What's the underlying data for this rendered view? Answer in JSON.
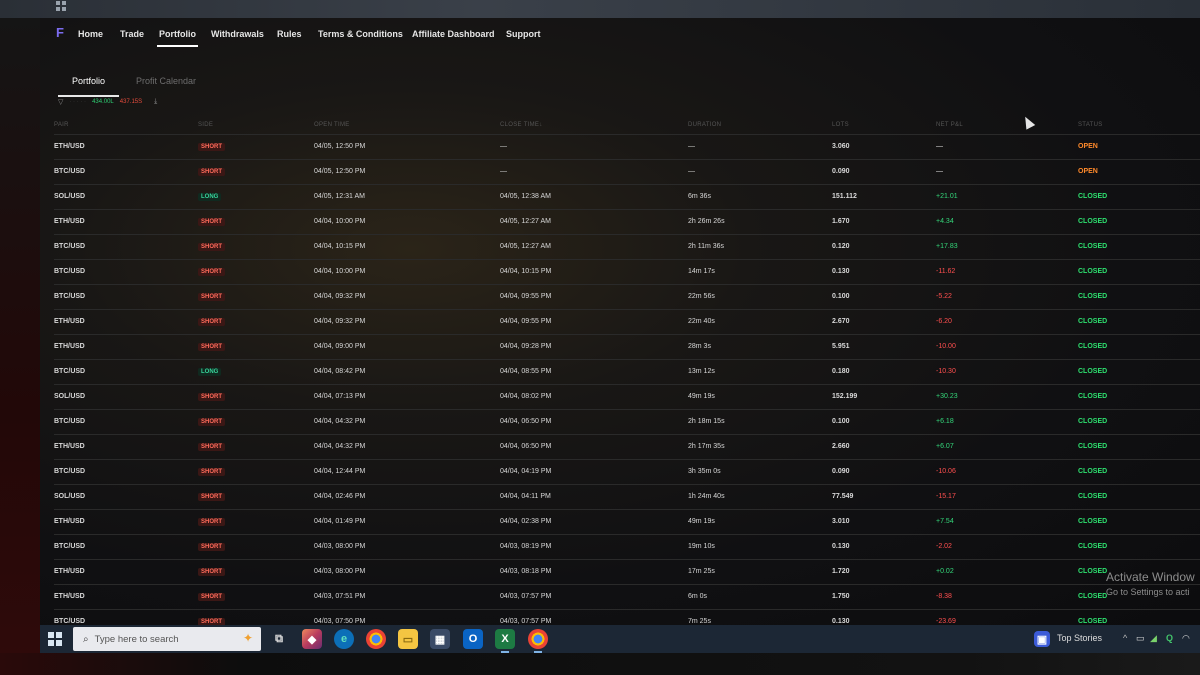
{
  "nav": {
    "items": [
      "Home",
      "Trade",
      "Portfolio",
      "Withdrawals",
      "Rules",
      "Terms & Conditions",
      "Affiliate Dashboard",
      "Support"
    ],
    "active": "Portfolio"
  },
  "subtabs": {
    "portfolio": "Portfolio",
    "calendar": "Profit Calendar"
  },
  "summary": {
    "positive": "434.00L",
    "negative": "437.15S"
  },
  "table": {
    "headers": {
      "pair": "PAIR",
      "side": "SIDE",
      "open_time": "OPEN TIME",
      "close_time": "CLOSE TIME↓",
      "duration": "DURATION",
      "lots": "LOTS",
      "net_pnl": "NET P&L",
      "status": "STATUS"
    },
    "rows": [
      {
        "pair": "ETH/USD",
        "side": "SHORT",
        "open": "04/05, 12:50 PM",
        "close": "—",
        "duration": "—",
        "lots": "3.060",
        "pnl": "—",
        "status": "OPEN"
      },
      {
        "pair": "BTC/USD",
        "side": "SHORT",
        "open": "04/05, 12:50 PM",
        "close": "—",
        "duration": "—",
        "lots": "0.090",
        "pnl": "—",
        "status": "OPEN"
      },
      {
        "pair": "SOL/USD",
        "side": "LONG",
        "open": "04/05, 12:31 AM",
        "close": "04/05, 12:38 AM",
        "duration": "6m 36s",
        "lots": "151.112",
        "pnl": "+21.01",
        "status": "CLOSED"
      },
      {
        "pair": "ETH/USD",
        "side": "SHORT",
        "open": "04/04, 10:00 PM",
        "close": "04/05, 12:27 AM",
        "duration": "2h 26m 26s",
        "lots": "1.670",
        "pnl": "+4.34",
        "status": "CLOSED"
      },
      {
        "pair": "BTC/USD",
        "side": "SHORT",
        "open": "04/04, 10:15 PM",
        "close": "04/05, 12:27 AM",
        "duration": "2h 11m 36s",
        "lots": "0.120",
        "pnl": "+17.83",
        "status": "CLOSED"
      },
      {
        "pair": "BTC/USD",
        "side": "SHORT",
        "open": "04/04, 10:00 PM",
        "close": "04/04, 10:15 PM",
        "duration": "14m 17s",
        "lots": "0.130",
        "pnl": "-11.62",
        "status": "CLOSED"
      },
      {
        "pair": "BTC/USD",
        "side": "SHORT",
        "open": "04/04, 09:32 PM",
        "close": "04/04, 09:55 PM",
        "duration": "22m 56s",
        "lots": "0.100",
        "pnl": "-5.22",
        "status": "CLOSED"
      },
      {
        "pair": "ETH/USD",
        "side": "SHORT",
        "open": "04/04, 09:32 PM",
        "close": "04/04, 09:55 PM",
        "duration": "22m 40s",
        "lots": "2.670",
        "pnl": "-6.20",
        "status": "CLOSED"
      },
      {
        "pair": "ETH/USD",
        "side": "SHORT",
        "open": "04/04, 09:00 PM",
        "close": "04/04, 09:28 PM",
        "duration": "28m 3s",
        "lots": "5.951",
        "pnl": "-10.00",
        "status": "CLOSED"
      },
      {
        "pair": "BTC/USD",
        "side": "LONG",
        "open": "04/04, 08:42 PM",
        "close": "04/04, 08:55 PM",
        "duration": "13m 12s",
        "lots": "0.180",
        "pnl": "-10.30",
        "status": "CLOSED"
      },
      {
        "pair": "SOL/USD",
        "side": "SHORT",
        "open": "04/04, 07:13 PM",
        "close": "04/04, 08:02 PM",
        "duration": "49m 19s",
        "lots": "152.199",
        "pnl": "+30.23",
        "status": "CLOSED"
      },
      {
        "pair": "BTC/USD",
        "side": "SHORT",
        "open": "04/04, 04:32 PM",
        "close": "04/04, 06:50 PM",
        "duration": "2h 18m 15s",
        "lots": "0.100",
        "pnl": "+6.18",
        "status": "CLOSED"
      },
      {
        "pair": "ETH/USD",
        "side": "SHORT",
        "open": "04/04, 04:32 PM",
        "close": "04/04, 06:50 PM",
        "duration": "2h 17m 35s",
        "lots": "2.660",
        "pnl": "+6.07",
        "status": "CLOSED"
      },
      {
        "pair": "BTC/USD",
        "side": "SHORT",
        "open": "04/04, 12:44 PM",
        "close": "04/04, 04:19 PM",
        "duration": "3h 35m 0s",
        "lots": "0.090",
        "pnl": "-10.06",
        "status": "CLOSED"
      },
      {
        "pair": "SOL/USD",
        "side": "SHORT",
        "open": "04/04, 02:46 PM",
        "close": "04/04, 04:11 PM",
        "duration": "1h 24m 40s",
        "lots": "77.549",
        "pnl": "-15.17",
        "status": "CLOSED"
      },
      {
        "pair": "ETH/USD",
        "side": "SHORT",
        "open": "04/04, 01:49 PM",
        "close": "04/04, 02:38 PM",
        "duration": "49m 19s",
        "lots": "3.010",
        "pnl": "+7.54",
        "status": "CLOSED"
      },
      {
        "pair": "BTC/USD",
        "side": "SHORT",
        "open": "04/03, 08:00 PM",
        "close": "04/03, 08:19 PM",
        "duration": "19m 10s",
        "lots": "0.130",
        "pnl": "-2.02",
        "status": "CLOSED"
      },
      {
        "pair": "ETH/USD",
        "side": "SHORT",
        "open": "04/03, 08:00 PM",
        "close": "04/03, 08:18 PM",
        "duration": "17m 25s",
        "lots": "1.720",
        "pnl": "+0.02",
        "status": "CLOSED"
      },
      {
        "pair": "ETH/USD",
        "side": "SHORT",
        "open": "04/03, 07:51 PM",
        "close": "04/03, 07:57 PM",
        "duration": "6m 0s",
        "lots": "1.750",
        "pnl": "-8.38",
        "status": "CLOSED"
      },
      {
        "pair": "BTC/USD",
        "side": "SHORT",
        "open": "04/03, 07:50 PM",
        "close": "04/03, 07:57 PM",
        "duration": "7m 25s",
        "lots": "0.130",
        "pnl": "-23.69",
        "status": "CLOSED"
      }
    ]
  },
  "watermark": {
    "title": "Activate Window",
    "subtitle": "Go to Settings to acti"
  },
  "taskbar": {
    "search_placeholder": "Type here to search",
    "news": "Top Stories",
    "colors": {
      "bar": "#1c2735",
      "accent": "#7fb3e6"
    }
  }
}
